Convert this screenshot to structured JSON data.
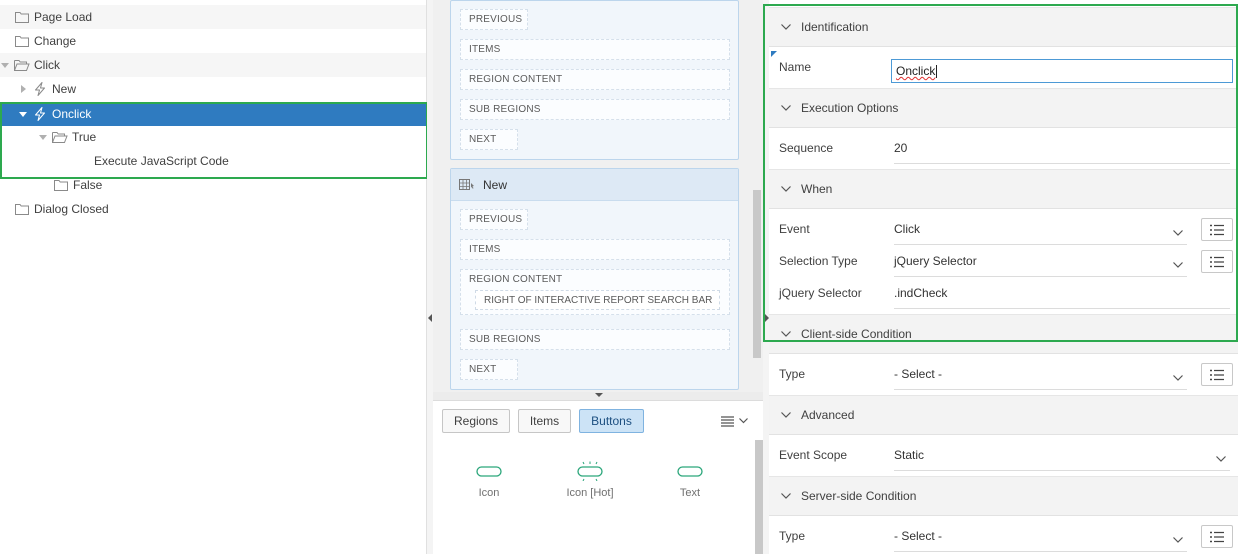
{
  "tree": {
    "rows": [
      {
        "label": "Page Load",
        "icon": "folder-icon",
        "toggle": "none"
      },
      {
        "label": "Change",
        "icon": "folder-icon",
        "toggle": "none"
      },
      {
        "label": "Click",
        "icon": "folder-open-icon",
        "toggle": "expanded"
      },
      {
        "label": "New",
        "icon": "lightning-icon",
        "toggle": "collapsed"
      },
      {
        "label": "Onclick",
        "icon": "lightning-icon",
        "toggle": "expanded",
        "selected": true
      },
      {
        "label": "True",
        "icon": "folder-open-icon",
        "toggle": "expanded"
      },
      {
        "label": "Execute JavaScript Code",
        "icon": "none",
        "toggle": "none"
      },
      {
        "label": "False",
        "icon": "folder-icon",
        "toggle": "none"
      },
      {
        "label": "Dialog Closed",
        "icon": "folder-icon",
        "toggle": "none"
      }
    ]
  },
  "layout": {
    "region1": {
      "slots": [
        "PREVIOUS",
        "ITEMS",
        "REGION CONTENT",
        "SUB REGIONS",
        "NEXT"
      ]
    },
    "region2": {
      "title": "New",
      "icon": "interactive-report-icon",
      "slots": [
        "PREVIOUS",
        "ITEMS",
        "REGION CONTENT",
        "SUB REGIONS",
        "NEXT"
      ],
      "inner_slot": "RIGHT OF INTERACTIVE REPORT SEARCH BAR"
    }
  },
  "gallery": {
    "tabs": [
      "Regions",
      "Items",
      "Buttons"
    ],
    "active_tab": "Buttons",
    "items": [
      {
        "label": "Icon",
        "icon": "button-icon"
      },
      {
        "label": "Icon [Hot]",
        "icon": "button-hot-icon"
      },
      {
        "label": "Text",
        "icon": "button-text-icon"
      }
    ]
  },
  "properties": {
    "groups": {
      "identification": "Identification",
      "execution": "Execution Options",
      "when": "When",
      "client_condition": "Client-side Condition",
      "advanced": "Advanced",
      "server_condition": "Server-side Condition"
    },
    "name": {
      "label": "Name",
      "value": "Onclick"
    },
    "sequence": {
      "label": "Sequence",
      "value": "20"
    },
    "event": {
      "label": "Event",
      "value": "Click"
    },
    "selection_type": {
      "label": "Selection Type",
      "value": "jQuery Selector"
    },
    "jquery_selector": {
      "label": "jQuery Selector",
      "value": ".indCheck"
    },
    "client_type": {
      "label": "Type",
      "value": "- Select -"
    },
    "event_scope": {
      "label": "Event Scope",
      "value": "Static"
    },
    "server_type": {
      "label": "Type",
      "value": "- Select -"
    }
  },
  "colors": {
    "selection": "#2f7bc0",
    "highlight": "#2da94f"
  }
}
